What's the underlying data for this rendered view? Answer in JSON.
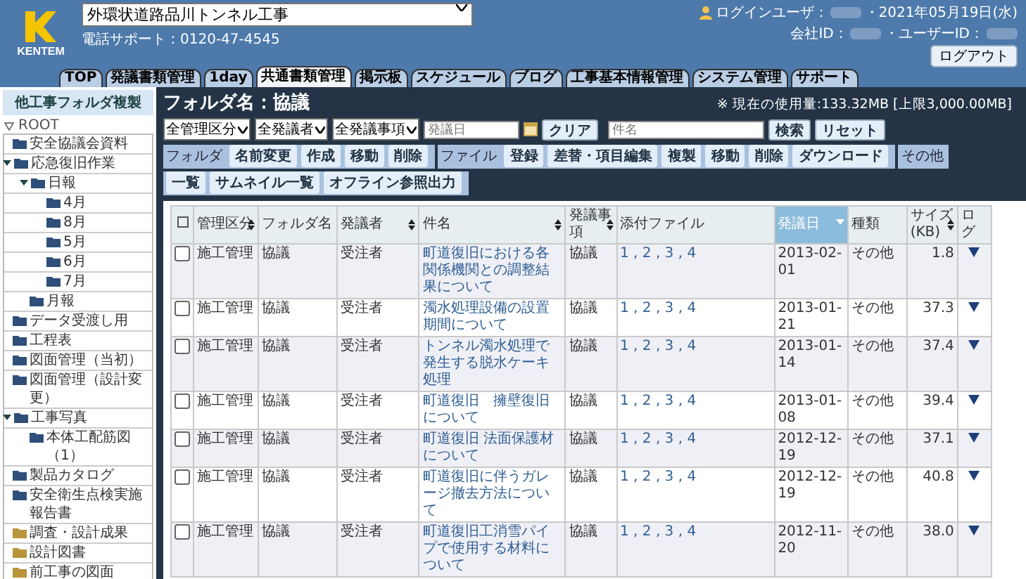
{
  "header": {
    "logo": "KENTEM",
    "project": "外環状道路品川トンネル工事",
    "support": "電話サポート：0120-47-4545",
    "login_label": "ログインユーザ：",
    "date": "・2021年05月19日(水)",
    "company_label": "会社ID：",
    "user_label": "・ユーザーID：",
    "logout": "ログアウト"
  },
  "tabs": [
    {
      "label": "TOP",
      "selected": false
    },
    {
      "label": "発議書類管理",
      "selected": false
    },
    {
      "label": "1day",
      "selected": false
    },
    {
      "label": "共通書類管理",
      "selected": true
    },
    {
      "label": "掲示板",
      "selected": false
    },
    {
      "label": "スケジュール",
      "selected": false
    },
    {
      "label": "ブログ",
      "selected": false
    },
    {
      "label": "工事基本情報管理",
      "selected": false
    },
    {
      "label": "システム管理",
      "selected": false
    },
    {
      "label": "サポート",
      "selected": false
    }
  ],
  "sidebar": {
    "copy_button": "他工事フォルダ複製",
    "root": "ROOT",
    "items": [
      {
        "label": "安全協議会資料",
        "color": "#2f4f7a"
      },
      {
        "label": "応急復旧作業",
        "color": "#2f4f7a",
        "expanded": true,
        "children": [
          {
            "label": "日報",
            "color": "#2f4f7a",
            "expanded": true,
            "children": [
              {
                "label": "4月",
                "color": "#2f4f7a"
              },
              {
                "label": "8月",
                "color": "#2f4f7a"
              },
              {
                "label": "5月",
                "color": "#2f4f7a"
              },
              {
                "label": "6月",
                "color": "#2f4f7a"
              },
              {
                "label": "7月",
                "color": "#2f4f7a"
              }
            ]
          },
          {
            "label": "月報",
            "color": "#2f4f7a"
          }
        ]
      },
      {
        "label": "データ受渡し用",
        "color": "#2f4f7a"
      },
      {
        "label": "工程表",
        "color": "#2f4f7a"
      },
      {
        "label": "図面管理（当初）",
        "color": "#2f4f7a"
      },
      {
        "label": "図面管理（設計変更）",
        "color": "#2f4f7a"
      },
      {
        "label": "工事写真",
        "color": "#2f4f7a",
        "expanded": true,
        "children": [
          {
            "label": "本体工配筋図（1）",
            "color": "#2f4f7a"
          }
        ]
      },
      {
        "label": "製品カタログ",
        "color": "#2f4f7a"
      },
      {
        "label": "安全衛生点検実施報告書",
        "color": "#2f4f7a"
      },
      {
        "label": "調査・設計成果",
        "color": "#b8943a"
      },
      {
        "label": "設計図書",
        "color": "#b8943a"
      },
      {
        "label": "前工事の図面",
        "color": "#b8943a"
      }
    ]
  },
  "folder": {
    "title": "フォルダ名：協議",
    "usage": "※ 現在の使用量:133.32MB [上限3,000.00MB]"
  },
  "filters": {
    "selects": [
      "全管理区分",
      "全発議者",
      "全発議事項"
    ],
    "date_placeholder": "発議日",
    "clear": "クリア",
    "subject_placeholder": "件名",
    "search": "検索",
    "reset": "リセット"
  },
  "toolbar": [
    {
      "label": "フォルダ",
      "buttons": [
        "名前変更",
        "作成",
        "移動",
        "削除"
      ]
    },
    {
      "label": "ファイル",
      "buttons": [
        "登録",
        "差替・項目編集",
        "複製",
        "移動",
        "削除",
        "ダウンロード"
      ]
    },
    {
      "label": "その他",
      "buttons": [
        "一覧",
        "サムネイル一覧",
        "オフライン参照出力"
      ]
    }
  ],
  "table": {
    "select_all_checked": false,
    "columns": [
      {
        "label": "管理区分",
        "sortable": true,
        "sorted": false
      },
      {
        "label": "フォルダ名",
        "sortable": false,
        "sorted": false
      },
      {
        "label": "発議者",
        "sortable": true,
        "sorted": false
      },
      {
        "label": "件名",
        "sortable": true,
        "sorted": false
      },
      {
        "label": "発議事項",
        "sortable": true,
        "sorted": false
      },
      {
        "label": "添付ファイル",
        "sortable": false,
        "sorted": false
      },
      {
        "label": "発議日",
        "sortable": true,
        "sorted": true
      },
      {
        "label": "種類",
        "sortable": false,
        "sorted": false
      },
      {
        "label": "サイズ(KB)",
        "sortable": true,
        "sorted": false
      },
      {
        "label": "ログ",
        "sortable": false,
        "sorted": false
      }
    ],
    "rows": [
      {
        "checked": false,
        "cells": [
          "施工管理",
          "協議",
          "受注者",
          "町道復旧における各関係機関との調整結果について",
          "協議",
          "1 , 2 , 3 , 4",
          "2013-02-01",
          "その他",
          "1.8"
        ]
      },
      {
        "checked": false,
        "cells": [
          "施工管理",
          "協議",
          "受注者",
          "濁水処理設備の設置期間について",
          "協議",
          "1 , 2 , 3 , 4",
          "2013-01-21",
          "その他",
          "37.3"
        ]
      },
      {
        "checked": false,
        "cells": [
          "施工管理",
          "協議",
          "受注者",
          "トンネル濁水処理で発生する脱水ケーキ処理",
          "協議",
          "1 , 2 , 3 , 4",
          "2013-01-14",
          "その他",
          "37.4"
        ]
      },
      {
        "checked": false,
        "cells": [
          "施工管理",
          "協議",
          "受注者",
          "町道復旧　擁壁復旧について",
          "協議",
          "1 , 2 , 3 , 4",
          "2013-01-08",
          "その他",
          "39.4"
        ]
      },
      {
        "checked": false,
        "cells": [
          "施工管理",
          "協議",
          "受注者",
          "町道復旧 法面保護材について",
          "協議",
          "1 , 2 , 3 , 4",
          "2012-12-19",
          "その他",
          "37.1"
        ]
      },
      {
        "checked": false,
        "cells": [
          "施工管理",
          "協議",
          "受注者",
          "町道復旧に伴うガレージ撤去方法について",
          "協議",
          "1 , 2 , 3 , 4",
          "2012-12-19",
          "その他",
          "40.8"
        ]
      },
      {
        "checked": false,
        "cells": [
          "施工管理",
          "協議",
          "受注者",
          "町道復旧工消雪パイプで使用する材料について",
          "協議",
          "1 , 2 , 3 , 4",
          "2012-11-20",
          "その他",
          "38.0"
        ]
      }
    ]
  }
}
